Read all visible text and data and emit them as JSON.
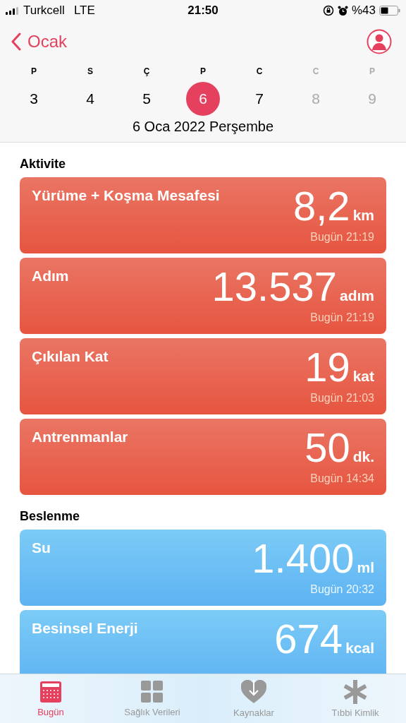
{
  "status_bar": {
    "carrier": "Turkcell",
    "network": "LTE",
    "time": "21:50",
    "battery_text": "%43"
  },
  "nav": {
    "back_label": "Ocak"
  },
  "week": [
    {
      "weekday": "P",
      "day": "3",
      "selected": false,
      "disabled": false
    },
    {
      "weekday": "S",
      "day": "4",
      "selected": false,
      "disabled": false
    },
    {
      "weekday": "Ç",
      "day": "5",
      "selected": false,
      "disabled": false
    },
    {
      "weekday": "P",
      "day": "6",
      "selected": true,
      "disabled": false
    },
    {
      "weekday": "C",
      "day": "7",
      "selected": false,
      "disabled": false
    },
    {
      "weekday": "C",
      "day": "8",
      "selected": false,
      "disabled": true
    },
    {
      "weekday": "P",
      "day": "9",
      "selected": false,
      "disabled": true
    }
  ],
  "date_label": "6 Oca 2022 Perşembe",
  "sections": [
    {
      "title": "Aktivite",
      "cards": [
        {
          "kind": "activity",
          "title": "Yürüme + Koşma Mesafesi",
          "value": "8,2",
          "unit": "km",
          "time": "Bugün 21:19"
        },
        {
          "kind": "activity",
          "title": "Adım",
          "value": "13.537",
          "unit": "adım",
          "time": "Bugün 21:19"
        },
        {
          "kind": "activity",
          "title": "Çıkılan Kat",
          "value": "19",
          "unit": "kat",
          "time": "Bugün 21:03"
        },
        {
          "kind": "activity",
          "title": "Antrenmanlar",
          "value": "50",
          "unit": "dk.",
          "time": "Bugün 14:34"
        }
      ]
    },
    {
      "title": "Beslenme",
      "cards": [
        {
          "kind": "nutrition",
          "title": "Su",
          "value": "1.400",
          "unit": "ml",
          "time": "Bugün 20:32"
        },
        {
          "kind": "nutrition",
          "title": "Besinsel Enerji",
          "value": "674",
          "unit": "kcal"
        }
      ]
    }
  ],
  "tabs": [
    {
      "label": "Bugün",
      "kind": "calendar",
      "selected": true
    },
    {
      "label": "Sağlık Verileri",
      "kind": "grid",
      "selected": false
    },
    {
      "label": "Kaynaklar",
      "kind": "heart",
      "selected": false
    },
    {
      "label": "Tıbbi Kimlik",
      "kind": "asterisk",
      "selected": false
    }
  ]
}
